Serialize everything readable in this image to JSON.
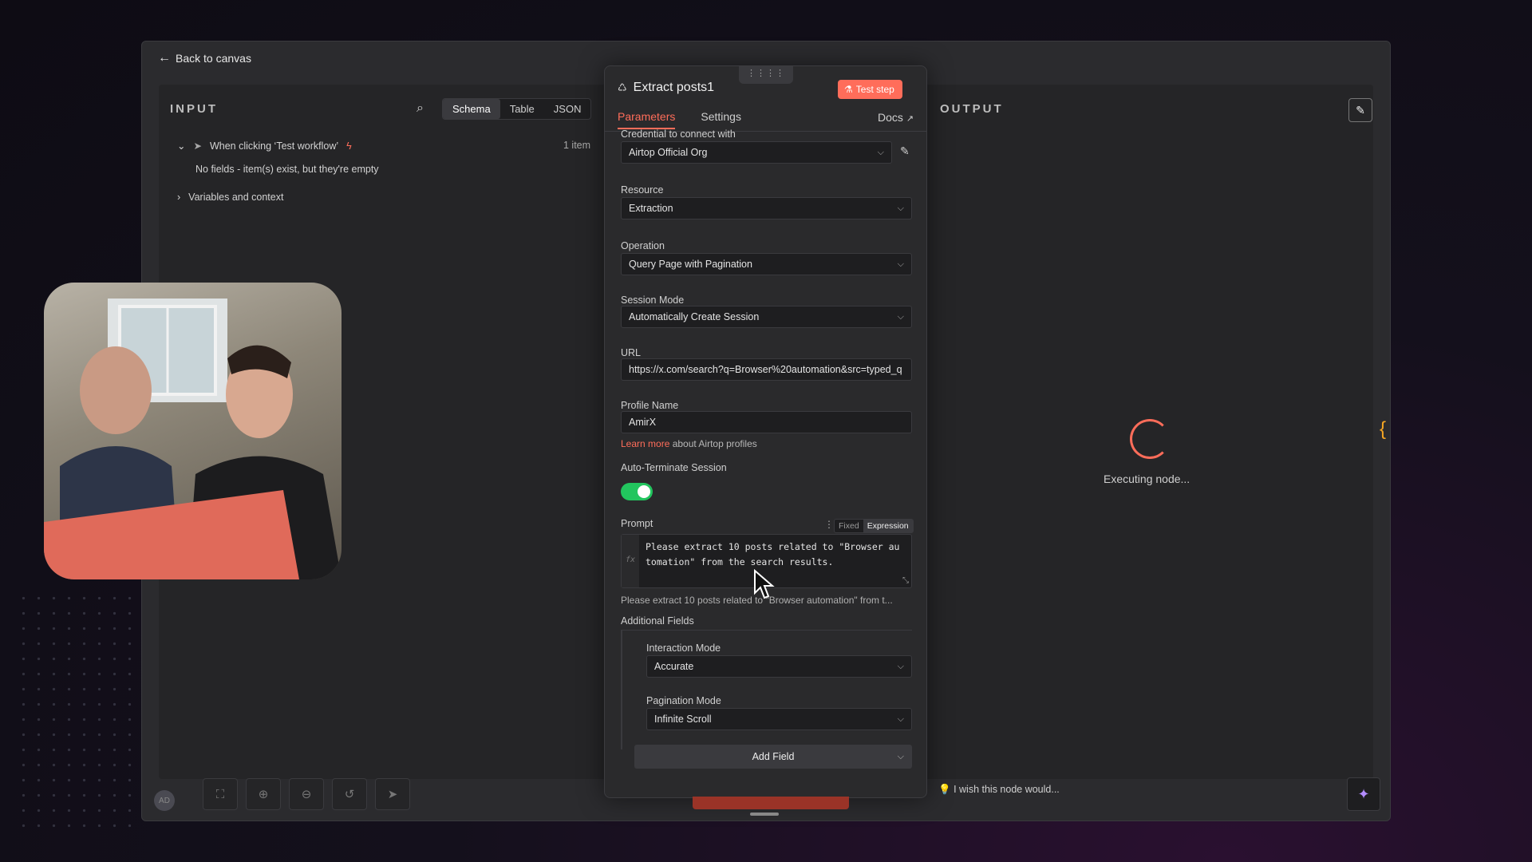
{
  "top": {
    "back_label": "Back to canvas"
  },
  "input_panel": {
    "title": "INPUT",
    "tabs": [
      "Schema",
      "Table",
      "JSON"
    ],
    "active_tab": "Schema",
    "trigger_label": "When clicking ‘Test workflow’",
    "item_count": "1 item",
    "empty_note": "No fields - item(s) exist, but they're empty",
    "variables_label": "Variables and context"
  },
  "node": {
    "title": "Extract posts1",
    "test_button": "Test step",
    "tabs": [
      "Parameters",
      "Settings"
    ],
    "active_tab": "Parameters",
    "docs_label": "Docs",
    "credential_label": "Credential to connect with",
    "credential_value": "Airtop Official Org",
    "resource_label": "Resource",
    "resource_value": "Extraction",
    "operation_label": "Operation",
    "operation_value": "Query Page with Pagination",
    "session_mode_label": "Session Mode",
    "session_mode_value": "Automatically Create Session",
    "url_label": "URL",
    "url_value": "https://x.com/search?q=Browser%20automation&src=typed_q",
    "profile_label": "Profile Name",
    "profile_value": "AmirX",
    "learn_more_link": "Learn more",
    "learn_more_rest": " about Airtop profiles",
    "auto_terminate_label": "Auto-Terminate Session",
    "auto_terminate_on": true,
    "prompt_label": "Prompt",
    "prompt_mode_fixed": "Fixed",
    "prompt_mode_expression": "Expression",
    "prompt_text": "Please extract 10 posts related to \"Browser au\ntomation\" from the search results.",
    "prompt_preview": "Please extract 10 posts related to \"Browser automation\" from t...",
    "additional_label": "Additional Fields",
    "interaction_label": "Interaction Mode",
    "interaction_value": "Accurate",
    "pagination_label": "Pagination Mode",
    "pagination_value": "Infinite Scroll",
    "add_field_label": "Add Field"
  },
  "output_panel": {
    "title": "OUTPUT",
    "status": "Executing node...",
    "wish_text": "I wish this node would..."
  },
  "colors": {
    "accent": "#ff6d5a",
    "toggle": "#22c55e",
    "ai": "#b38cff"
  }
}
